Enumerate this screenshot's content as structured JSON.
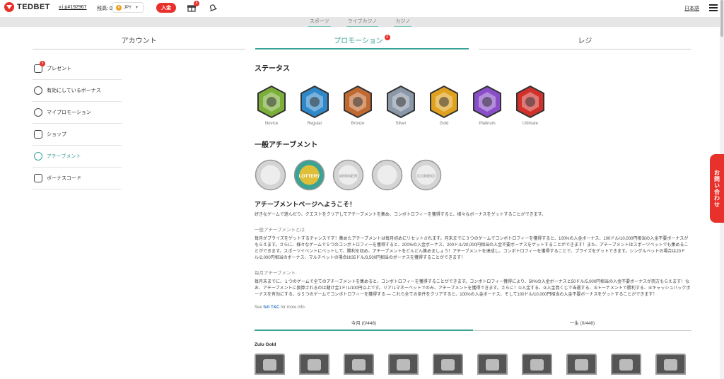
{
  "header": {
    "brand": "TEDBET",
    "user_id": "v.i.p#192967",
    "balance_label": "残高: 0",
    "currency": "JPY",
    "deposit_label": "入金",
    "gift_count": "5",
    "language": "日本語"
  },
  "subnav": [
    "スポーツ",
    "ライブカジノ",
    "カジノ"
  ],
  "tabs": [
    {
      "label": "アカウント",
      "active": false
    },
    {
      "label": "プロモーション",
      "active": true,
      "badge": "5"
    },
    {
      "label": "レジ",
      "active": false
    }
  ],
  "sidebar": {
    "items": [
      {
        "label": "プレゼント",
        "badge": "5",
        "icon": "gift-icon"
      },
      {
        "label": "有効にしているボーナス",
        "icon": "bonus-icon"
      },
      {
        "label": "マイプロモーション",
        "icon": "promo-icon"
      },
      {
        "label": "ショップ",
        "icon": "cart-icon"
      },
      {
        "label": "アチーブメント",
        "icon": "chart-icon",
        "active": true
      },
      {
        "label": "ボーナスコード",
        "icon": "code-icon"
      }
    ]
  },
  "main": {
    "status_title": "ステータス",
    "statuses": [
      {
        "label": "Novice",
        "color": "#7cae3a"
      },
      {
        "label": "Regular",
        "color": "#2e88c9"
      },
      {
        "label": "Bronze",
        "color": "#c06a32"
      },
      {
        "label": "Silver",
        "color": "#8a98a8"
      },
      {
        "label": "Gold",
        "color": "#e0a21e"
      },
      {
        "label": "Platinum",
        "color": "#8a4fc8"
      },
      {
        "label": "Ultimate",
        "color": "#d0312b"
      }
    ],
    "achievements_title": "一般アチーブメント",
    "achievements": [
      {
        "icon": "arrow-icon"
      },
      {
        "icon": "lottery-icon",
        "label": "LOTTERY"
      },
      {
        "icon": "winner-icon",
        "label": "WINNER"
      },
      {
        "icon": "hand-icon"
      },
      {
        "icon": "combo-icon",
        "label": "COMBO"
      }
    ],
    "welcome": "アチーブメントページへようこそ！",
    "intro": "好きなゲームで遊んだり、クエストをクリアしてアチーブメントを集め、コンボトロフィーを獲得すると、様々なボーナスをゲットすることができます。",
    "general_head": "一般アチーブメントとは",
    "general_text": "毎月がプライズをゲットするチャンスです！集めたアチーブメントは毎月初めにリセットされます。月末までに３つのゲームでコンボトロフィーを獲得すると、100%の入金ボーナス、100ドル/10,000円相当の入金不要ボーナスがもらえます。さらに、様々なゲームで５つのコンボトロフィーを獲得すると、200%の入金ボーナス、200ドル/20,000円相当の入金不要ボーナスをゲットすることができます！また、アチーブメントはスポーツベットでも集めることができます。スポーツイベントにベットして、勝利を収め、アチーブメントをどんどん集めましょう！アチーブメントを達成し、コンボトロフィーを獲得することで、プライズをゲットできます。シングルベットの場合は20ドル/2,000円相当のボーナス、マルチベットの場合は35ドル/3,500円相当のボーナスを獲得することができます！",
    "monthly_head": "毎月アチーブメント:",
    "monthly_text": "毎月末までに、１つのゲームで全てのアチーブメントを集めると、コンボトロフィーを獲得することができます。コンボトロフィー獲得により、50%の入金ボーナスと50ドル/5,000円相当の入金不要ボーナスが両方もらえます！なお、アチーブメントに換算されるのは賭け金1ドル/100円以上です。リアルマネーベットでのみ、アチーブメントを獲得できます。さらに！①入金する、②入金寛くじで当選する、③トーナメントで勝利する、④キャッシュバックボーナスを有効にする、⑤５つのゲームでコンボトロフィーを獲得する ― これら全ての条件をクリアすると、100%の入金ボーナス、そして100ドル/10,000円相当の入金不要ボーナスをゲットすることができます！",
    "tc_prefix": "See",
    "tc_link": "full T&C",
    "tc_suffix": "for more info.",
    "progress_tabs": [
      {
        "label": "今月 (0/448)",
        "active": true
      },
      {
        "label": "一生 (0/448)",
        "active": false
      }
    ],
    "game_title": "Zulu Gold",
    "game_icons": [
      "game-1",
      "game-2",
      "game-3",
      "game-4",
      "game-5",
      "game-6",
      "game-7",
      "game-8",
      "game-9",
      "game-10"
    ]
  },
  "contact_tab": "お問い合わせ"
}
